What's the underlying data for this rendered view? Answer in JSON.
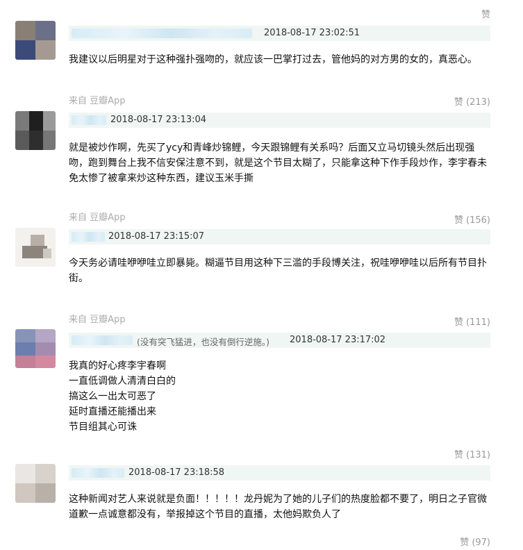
{
  "top_like": {
    "label": "赞",
    "count": ""
  },
  "comments": [
    {
      "time": "2018-08-17 23:02:51",
      "motto": "",
      "lines": [
        "我建议以后明星对于这种强扑强吻的，就应该一巴掌打过去，管他妈的对方男的女的，真恶心。"
      ],
      "source": "来自 豆瓣App",
      "like_label": "赞",
      "likes": "(213)"
    },
    {
      "time": "2018-08-17 23:13:04",
      "motto": "",
      "lines": [
        "就是被炒作啊，先买了ycy和青峰炒锦鲤，今天跟锦鲤有关系吗？后面又立马切镜头然后出现强",
        "吻，跑到舞台上我不信安保注意不到，就是这个节目太糊了，只能拿这种下作手段炒作，李宇春未",
        "免太惨了被拿来炒这种东西，建议玉米手撕"
      ],
      "source": "来自 豆瓣App",
      "like_label": "赞",
      "likes": "(156)"
    },
    {
      "time": "2018-08-17 23:15:07",
      "motto": "",
      "lines": [
        "今天务必请哇咿咿哇立即暴毙。糊逼节目用这种下三滥的手段博关注，祝哇咿咿哇以后所有节目扑",
        "街。"
      ],
      "source": "来自 豆瓣App",
      "like_label": "赞",
      "likes": "(111)"
    },
    {
      "time": "2018-08-17 23:17:02",
      "motto": "(没有突飞猛进，也没有倒行逆施。)",
      "lines": [
        "我真的好心疼李宇春啊",
        "一直低调做人清清白白的",
        "搞这么一出太可恶了",
        "延时直播还能播出来",
        "节目组其心可诛"
      ],
      "source": "",
      "like_label": "赞",
      "likes": "(131)"
    },
    {
      "time": "2018-08-17 23:18:58",
      "motto": "",
      "lines": [
        "这种新闻对艺人来说就是负面！！！！！龙丹妮为了她的儿子们的热度脸都不要了，明日之子官微",
        "道歉一点诚意都没有，举报掉这个节目的直播，太他妈欺负人了"
      ],
      "source": "",
      "like_label": "赞",
      "likes": "(97)"
    }
  ]
}
